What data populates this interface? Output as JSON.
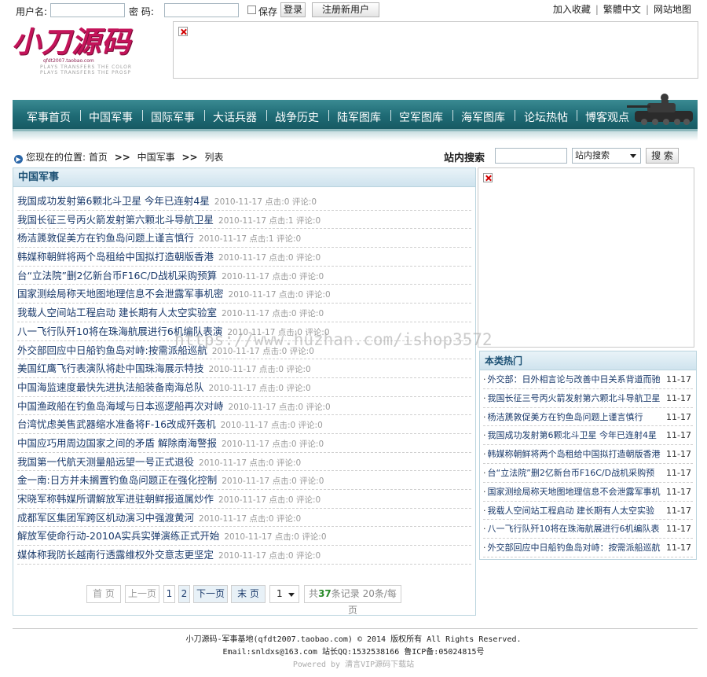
{
  "login": {
    "username_label": "用户名:",
    "password_label": "密  码:",
    "remember_label": "保存",
    "login_button": "登录",
    "register_button": "注册新用户"
  },
  "top_links": [
    "加入收藏",
    "繁體中文",
    "网站地图"
  ],
  "logo": {
    "title": "小刀源码",
    "subtitle": "qfdt2007.taobao.com",
    "tagline1": "PLAYS TRANSFERS THE COLOR",
    "tagline2": "PLAYS TRANSFERS THE PROSP"
  },
  "nav": [
    "军事首页",
    "中国军事",
    "国际军事",
    "大话兵器",
    "战争历史",
    "陆军图库",
    "空军图库",
    "海军图库",
    "论坛热帖",
    "博客观点"
  ],
  "breadcrumb": {
    "prefix": "您现在的位置:",
    "items": [
      "首页",
      "中国军事",
      "列表"
    ],
    "separator": ">>"
  },
  "search": {
    "label": "站内搜索",
    "select_value": "站内搜索",
    "button": "搜 索"
  },
  "main": {
    "title": "中国军事",
    "articles": [
      {
        "title": "我国成功发射第6颗北斗卫星 今年已连射4星",
        "date": "2010-11-17",
        "clicks": "点击:0",
        "comments": "评论:0"
      },
      {
        "title": "我国长征三号丙火箭发射第六颗北斗导航卫星",
        "date": "2010-11-17",
        "clicks": "点击:1",
        "comments": "评论:0"
      },
      {
        "title": "杨洁篪敦促美方在钓鱼岛问题上谨言慎行",
        "date": "2010-11-17",
        "clicks": "点击:1",
        "comments": "评论:0"
      },
      {
        "title": "韩媒称朝鲜将两个岛租给中国拟打造朝版香港",
        "date": "2010-11-17",
        "clicks": "点击:0",
        "comments": "评论:0"
      },
      {
        "title": "台“立法院”删2亿新台币F16C/D战机采购预算",
        "date": "2010-11-17",
        "clicks": "点击:0",
        "comments": "评论:0"
      },
      {
        "title": "国家测绘局称天地图地理信息不会泄露军事机密",
        "date": "2010-11-17",
        "clicks": "点击:0",
        "comments": "评论:0"
      },
      {
        "title": "我载人空间站工程启动 建长期有人太空实验室",
        "date": "2010-11-17",
        "clicks": "点击:0",
        "comments": "评论:0"
      },
      {
        "title": "八一飞行队歼10将在珠海航展进行6机编队表演",
        "date": "2010-11-17",
        "clicks": "点击:0",
        "comments": "评论:0"
      },
      {
        "title": "外交部回应中日船钓鱼岛对峙:按需派船巡航",
        "date": "2010-11-17",
        "clicks": "点击:0",
        "comments": "评论:0"
      },
      {
        "title": "美国红鹰飞行表演队将赴中国珠海展示特技",
        "date": "2010-11-17",
        "clicks": "点击:0",
        "comments": "评论:0"
      },
      {
        "title": "中国海监速度最快先进执法船装备南海总队",
        "date": "2010-11-17",
        "clicks": "点击:0",
        "comments": "评论:0"
      },
      {
        "title": "中国渔政船在钓鱼岛海域与日本巡逻船再次对峙",
        "date": "2010-11-17",
        "clicks": "点击:0",
        "comments": "评论:0"
      },
      {
        "title": "台湾忧虑美售武器缩水准备将F-16改成歼轰机",
        "date": "2010-11-17",
        "clicks": "点击:0",
        "comments": "评论:0"
      },
      {
        "title": "中国应巧用周边国家之间的矛盾 解除南海警报",
        "date": "2010-11-17",
        "clicks": "点击:0",
        "comments": "评论:0"
      },
      {
        "title": "我国第一代航天测量船远望一号正式退役",
        "date": "2010-11-17",
        "clicks": "点击:0",
        "comments": "评论:0"
      },
      {
        "title": "金一南:日方并未搁置钓鱼岛问题正在强化控制",
        "date": "2010-11-17",
        "clicks": "点击:0",
        "comments": "评论:0"
      },
      {
        "title": "宋晓军称韩媒所谓解放军进驻朝鲜报道属炒作",
        "date": "2010-11-17",
        "clicks": "点击:0",
        "comments": "评论:0"
      },
      {
        "title": "成都军区集团军跨区机动演习中强渡黄河",
        "date": "2010-11-17",
        "clicks": "点击:0",
        "comments": "评论:0"
      },
      {
        "title": "解放军使命行动-2010A实兵实弹演练正式开始",
        "date": "2010-11-17",
        "clicks": "点击:0",
        "comments": "评论:0"
      },
      {
        "title": "媒体称我防长越南行透露维权外交意志更坚定",
        "date": "2010-11-17",
        "clicks": "点击:0",
        "comments": "评论:0"
      }
    ]
  },
  "pager": {
    "first": "首 页",
    "prev": "上一页",
    "pages": [
      "1",
      "2"
    ],
    "next": "下一页",
    "last": "末 页",
    "select_value": "1",
    "total_prefix": "共",
    "total_count": "37",
    "total_suffix": "条记录",
    "per_page": "20条/每页"
  },
  "hot": {
    "title": "本类热门",
    "items": [
      {
        "title": "外交部：日外相言论与改善中日关系背道而驰",
        "date": "11-17"
      },
      {
        "title": "我国长征三号丙火箭发射第六颗北斗导航卫星",
        "date": "11-17"
      },
      {
        "title": "杨洁篪敦促美方在钓鱼岛问题上谨言慎行",
        "date": "11-17"
      },
      {
        "title": "我国成功发射第6颗北斗卫星 今年已连射4星",
        "date": "11-17"
      },
      {
        "title": "韩媒称朝鲜将两个岛租给中国拟打造朝版香港",
        "date": "11-17"
      },
      {
        "title": "台“立法院”删2亿新台币F16C/D战机采购预",
        "date": "11-17"
      },
      {
        "title": "国家测绘局称天地图地理信息不会泄露军事机",
        "date": "11-17"
      },
      {
        "title": "我载人空间站工程启动 建长期有人太空实验",
        "date": "11-17"
      },
      {
        "title": "八一飞行队歼10将在珠海航展进行6机编队表",
        "date": "11-17"
      },
      {
        "title": "外交部回应中日船钓鱼岛对峙：按需派船巡航",
        "date": "11-17"
      }
    ]
  },
  "footer": {
    "line1": "小刀源码-军事基地(qfdt2007.taobao.com) © 2014 版权所有 All Rights Reserved.",
    "line2": "Email:snldxs@163.com 站长QQ:1532538166 鲁ICP备:05024815号",
    "line3": "Powered by 清言VIP源码下载站"
  },
  "watermark": "https://www.huzhan.com/ishop3572"
}
